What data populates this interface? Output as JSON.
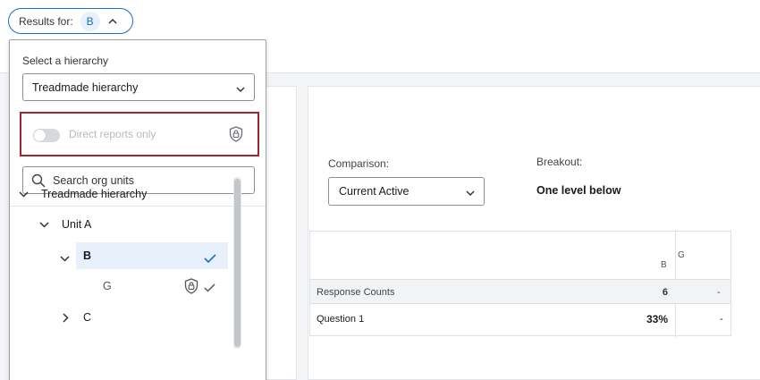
{
  "results_pill": {
    "label": "Results for:",
    "value": "B"
  },
  "panel": {
    "hierarchy_label": "Select a hierarchy",
    "hierarchy_selected": "Treadmade hierarchy",
    "direct_reports_label": "Direct reports only",
    "direct_reports_on": false,
    "search_placeholder": "Search org units",
    "tree": {
      "root": "Treadmade hierarchy",
      "unit_a": "Unit A",
      "b": "B",
      "g": "G",
      "c": "C"
    }
  },
  "report": {
    "comparison_label": "Comparison:",
    "comparison_value": "Current Active",
    "breakout_label": "Breakout:",
    "breakout_value": "One level below",
    "table": {
      "columns": [
        "B",
        "G"
      ],
      "rows": [
        {
          "name": "Response Counts",
          "values": [
            "6",
            "-"
          ]
        },
        {
          "name": "Question 1",
          "values": [
            "33%",
            "-"
          ]
        }
      ]
    }
  },
  "colors": {
    "accent": "#1f6fbf",
    "highlight_border": "#a4232f",
    "selected_row": "#e8f0fb"
  }
}
